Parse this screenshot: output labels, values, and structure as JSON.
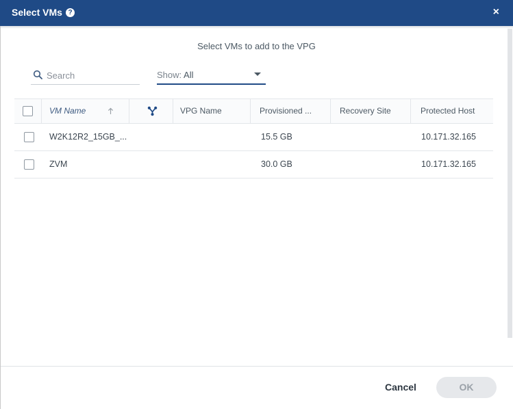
{
  "dialog": {
    "title": "Select VMs",
    "help_icon": "question-circle-icon",
    "close_glyph": "×",
    "subtitle": "Select VMs to add to the VPG"
  },
  "filters": {
    "search_placeholder": "Search",
    "show_label": "Show:",
    "show_value": "All"
  },
  "grid": {
    "columns": [
      {
        "key": "select",
        "label": ""
      },
      {
        "key": "vm_name",
        "label": "VM Name",
        "sort": "ascending"
      },
      {
        "key": "relation",
        "label": "",
        "icon": "fork-icon"
      },
      {
        "key": "vpg_name",
        "label": "VPG Name"
      },
      {
        "key": "provisioned",
        "label": "Provisioned ..."
      },
      {
        "key": "recovery_site",
        "label": "Recovery Site"
      },
      {
        "key": "protected_host",
        "label": "Protected Host"
      }
    ],
    "rows": [
      {
        "vm_name": "W2K12R2_15GB_...",
        "vpg_name": "",
        "provisioned": "15.5 GB",
        "recovery_site": "",
        "protected_host": "10.171.32.165"
      },
      {
        "vm_name": "ZVM",
        "vpg_name": "",
        "provisioned": "30.0 GB",
        "recovery_site": "",
        "protected_host": "10.171.32.165"
      }
    ]
  },
  "footer": {
    "cancel_label": "Cancel",
    "ok_label": "OK"
  },
  "colors": {
    "titlebar": "#1f4a86",
    "accent": "#1f4a86",
    "ok_disabled_bg": "#e6e8eb"
  }
}
